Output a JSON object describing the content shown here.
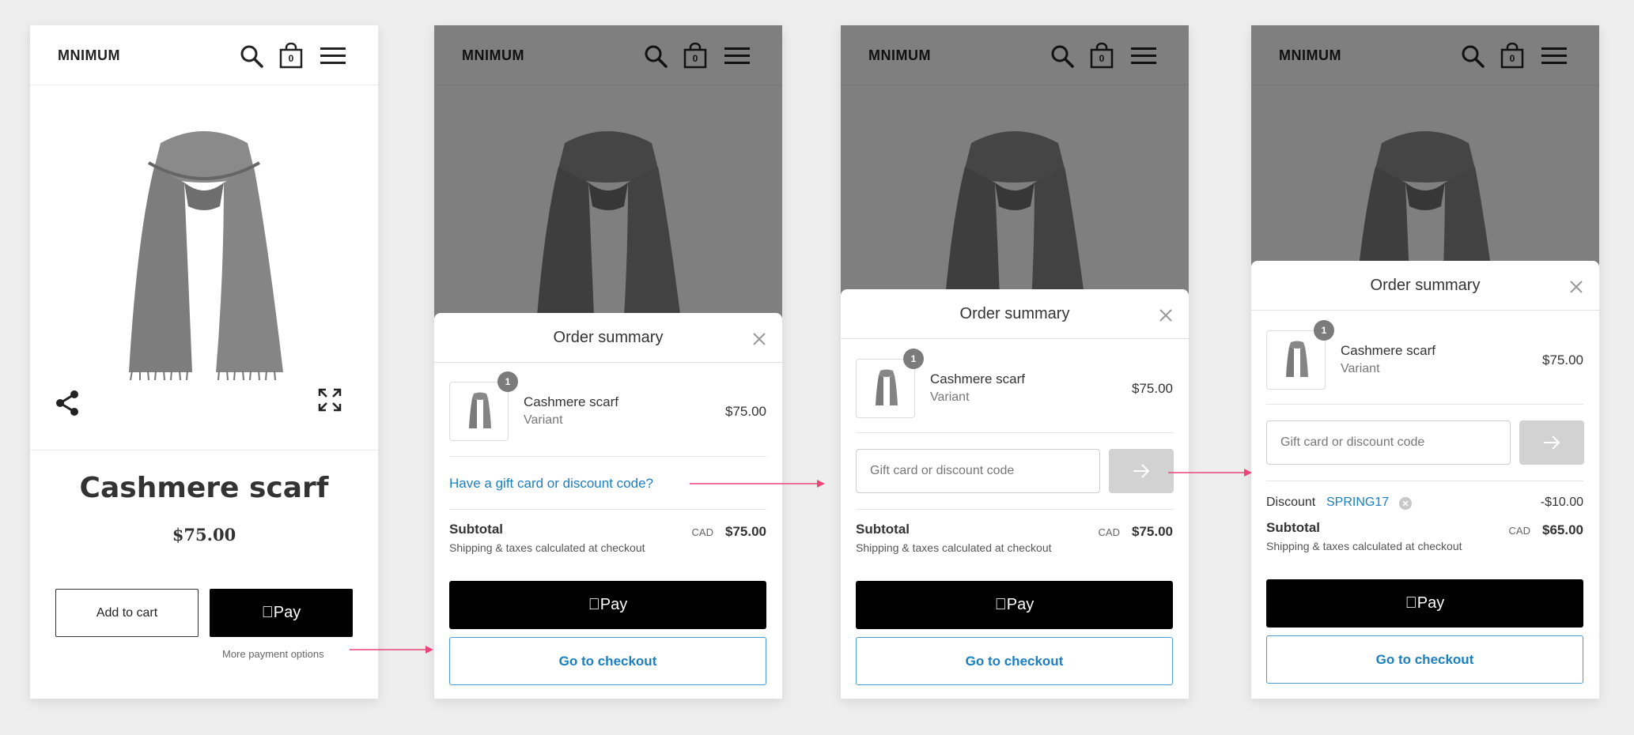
{
  "store": {
    "logo": "MNIMUM",
    "cart_count": "0"
  },
  "product": {
    "title": "Cashmere scarf",
    "price": "$75.00",
    "add_to_cart_label": "Add to cart",
    "apple_pay_label": "Pay",
    "more_payment_options": "More payment options"
  },
  "order_summary": {
    "title": "Order summary",
    "item": {
      "name": "Cashmere scarf",
      "variant": "Variant",
      "price": "$75.00",
      "quantity": "1"
    },
    "gift_link": "Have a gift card or discount code?",
    "gift_placeholder": "Gift card or discount code",
    "discount": {
      "label": "Discount",
      "code": "SPRING17",
      "amount": "-$10.00"
    },
    "subtotal": {
      "label": "Subtotal",
      "note": "Shipping & taxes calculated at checkout",
      "currency": "CAD",
      "amount": "$75.00",
      "amount_discounted": "$65.00"
    },
    "apple_pay_label": "Pay",
    "checkout_label": "Go to checkout"
  },
  "colors": {
    "link": "#1a7fc1",
    "arrow": "#e8467a",
    "apple_pay_bg": "#000000",
    "badge": "#7b7b7b"
  }
}
